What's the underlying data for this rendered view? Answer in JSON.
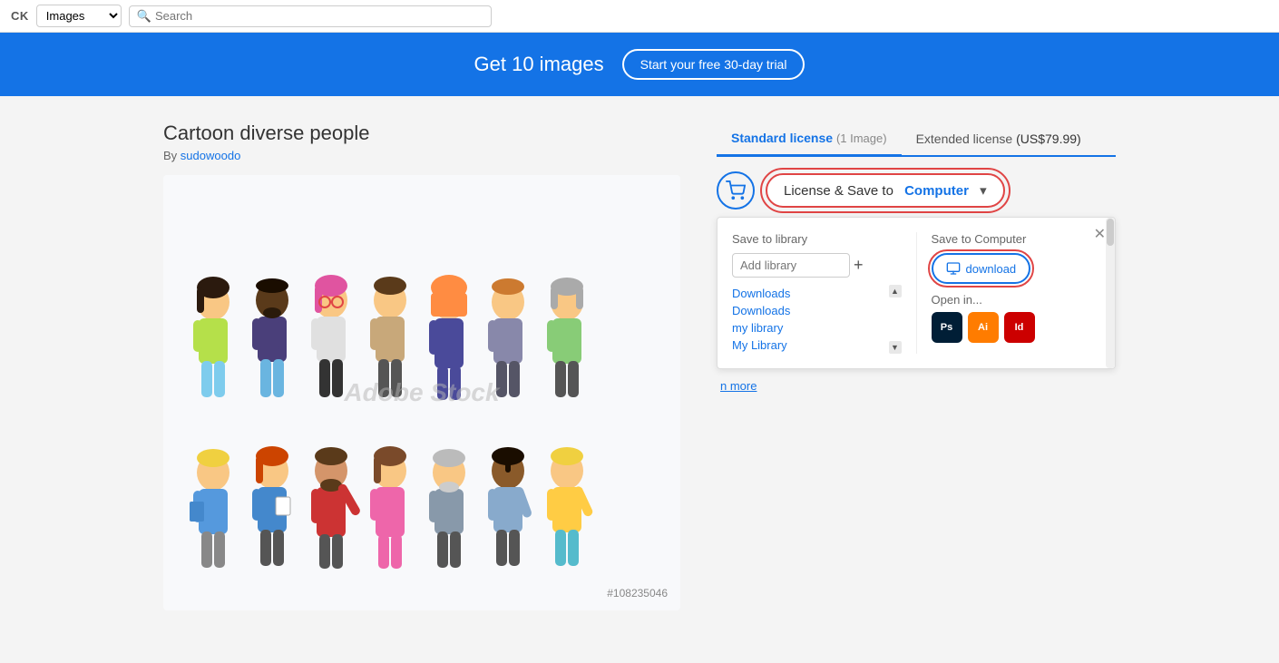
{
  "topbar": {
    "brand": "CK",
    "category": "Images",
    "search_placeholder": "Search"
  },
  "banner": {
    "text": "Get 10 images",
    "cta_label": "Start your free 30-day trial"
  },
  "image": {
    "title": "Cartoon diverse people",
    "author_prefix": "By",
    "author": "sudowoodo",
    "asset_id": "#108235046",
    "watermark": "Adobe Stock"
  },
  "license_panel": {
    "tabs": [
      {
        "label": "Standard license",
        "detail": "(1 Image)",
        "active": true
      },
      {
        "label": "Extended license",
        "detail": "(US$79.99)",
        "active": false
      }
    ],
    "license_save_btn": {
      "prefix": "License & Save to",
      "highlight": "Computer",
      "arrow": "▾"
    },
    "dropdown": {
      "save_library_label": "Save to library",
      "add_library_placeholder": "Add library",
      "libraries": [
        "Downloads",
        "Downloads",
        "my library",
        "My Library"
      ],
      "save_computer_label": "Save to Computer",
      "download_btn_label": "download",
      "open_in_label": "Open in...",
      "apps": [
        {
          "name": "Ps",
          "color_class": "app-ps",
          "label": "Photoshop"
        },
        {
          "name": "Ai",
          "color_class": "app-ai",
          "label": "Illustrator"
        },
        {
          "name": "Id",
          "color_class": "app-id",
          "label": "InDesign"
        }
      ]
    },
    "learn_more": "n more"
  }
}
